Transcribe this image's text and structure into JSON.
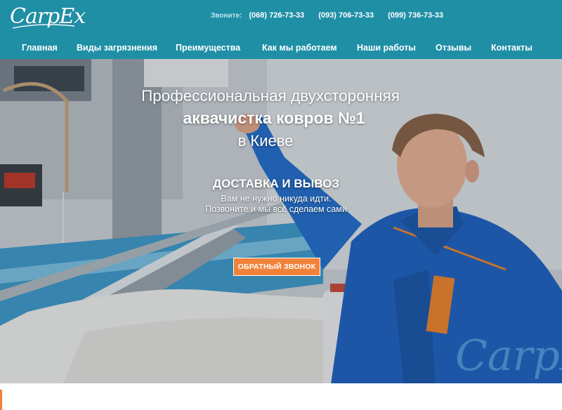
{
  "header": {
    "logo_text": "CarpEx",
    "phones_label": "Звоните:",
    "phones": [
      "(068) 726-73-33",
      "(093) 706-73-33",
      "(099) 736-73-33"
    ]
  },
  "nav": {
    "items": [
      "Главная",
      "Виды загрязнения",
      "Преимущества",
      "Как мы работаем",
      "Наши работы",
      "Отзывы",
      "Контакты"
    ]
  },
  "hero": {
    "line1": "Профессиональная двухсторонняя",
    "line2": "аквачистка ковров №1",
    "line3": "в Киеве",
    "subheading": "ДОСТАВКА И ВЫВОЗ",
    "text1": "Вам не нужно никуда идти.",
    "text2": "Позвоните и мы всё сделаем сами",
    "cta_label": "ОБРАТНЫЙ ЗВОНОК",
    "watermark_text": "CarpEx"
  },
  "colors": {
    "header_bg": "#1f8fa6",
    "cta_bg": "#f2823a",
    "uniform_blue": "#1f63c2"
  }
}
